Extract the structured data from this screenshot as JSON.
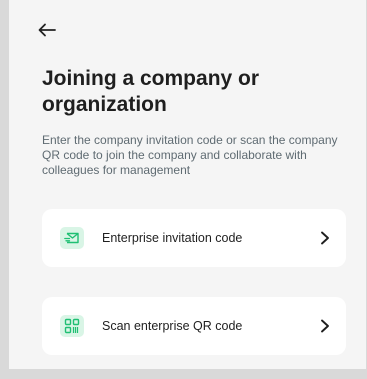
{
  "header": {
    "back_icon": "arrow-left-icon"
  },
  "main": {
    "title": "Joining a company or organization",
    "description": "Enter the company invitation code or scan the company QR code to join the company and collaborate with colleagues for management"
  },
  "options": [
    {
      "label": "Enterprise invitation code",
      "icon": "envelope-icon",
      "trailing_icon": "chevron-right-icon"
    },
    {
      "label": "Scan enterprise QR code",
      "icon": "qr-code-icon",
      "trailing_icon": "chevron-right-icon"
    }
  ],
  "colors": {
    "accent": "#1fbf73",
    "icon_bg": "#d9f5e6",
    "background": "#f5f5f5",
    "card": "#ffffff"
  }
}
